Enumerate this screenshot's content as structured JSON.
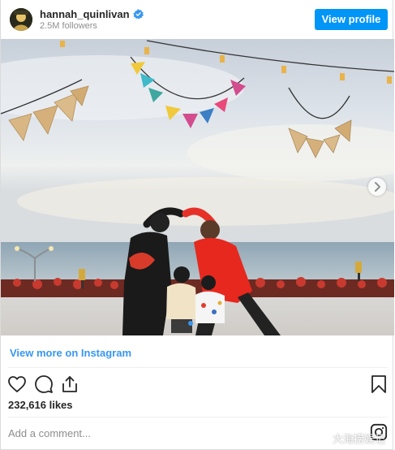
{
  "header": {
    "username": "hannah_quinlivan",
    "verified": true,
    "followers": "2.5M followers",
    "view_profile_label": "View profile"
  },
  "post": {
    "photo_icon": "photo-carousel",
    "carousel_next_icon": "chevron-right-icon",
    "view_more_label": "View more on Instagram",
    "likes": "232,616 likes",
    "comment_placeholder": "Add a comment...",
    "watermark": "大海捞娱记"
  },
  "icons": {
    "like": "heart-icon",
    "comment": "comment-bubble-icon",
    "share": "share-upload-icon",
    "save": "bookmark-icon",
    "instagram": "instagram-glyph-icon"
  },
  "colors": {
    "accent": "#0095f6",
    "link": "#3897f0",
    "muted": "#8e8e8e"
  }
}
